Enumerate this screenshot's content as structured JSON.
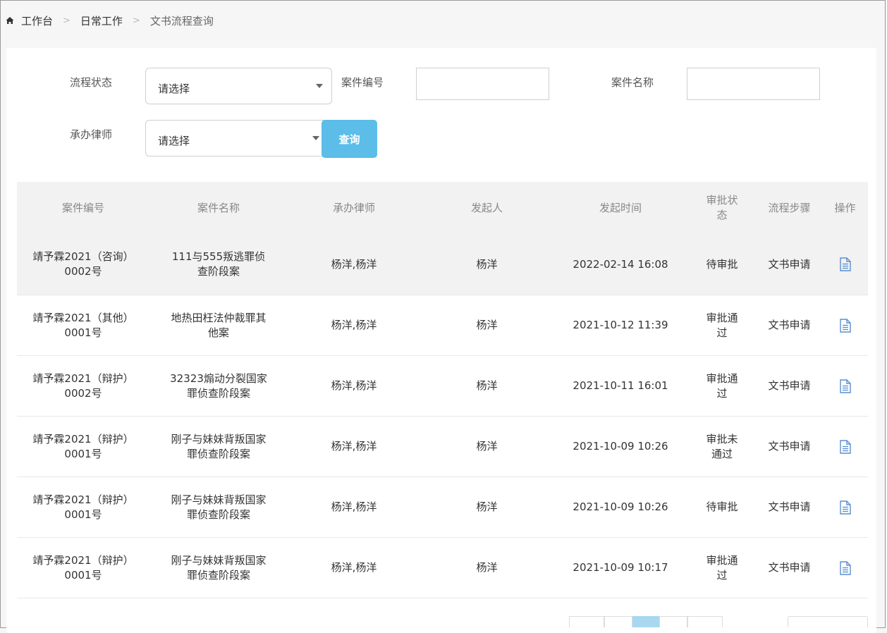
{
  "breadcrumb": {
    "items": [
      "工作台",
      "日常工作",
      "文书流程查询"
    ],
    "separator": ">"
  },
  "filters": {
    "status_label": "流程状态",
    "status_value": "请选择",
    "case_no_label": "案件编号",
    "case_no_value": "",
    "case_name_label": "案件名称",
    "case_name_value": "",
    "lawyer_label": "承办律师",
    "lawyer_value": "请选择",
    "query_button": "查询"
  },
  "table": {
    "headers": [
      "案件编号",
      "案件名称",
      "承办律师",
      "发起人",
      "发起时间",
      "审批状态",
      "流程步骤",
      "操作"
    ],
    "rows": [
      {
        "case_no": "靖予霖2021（咨询）0002号",
        "case_name": "111与555叛逃罪侦查阶段案",
        "lawyer": "杨洋,杨洋",
        "initiator": "杨洋",
        "time": "2022-02-14 16:08",
        "status": "待审批",
        "step": "文书申请"
      },
      {
        "case_no": "靖予霖2021（其他）0001号",
        "case_name": "地热田枉法仲裁罪其他案",
        "lawyer": "杨洋,杨洋",
        "initiator": "杨洋",
        "time": "2021-10-12 11:39",
        "status": "审批通过",
        "step": "文书申请"
      },
      {
        "case_no": "靖予霖2021（辩护）0002号",
        "case_name": "32323煽动分裂国家罪侦查阶段案",
        "lawyer": "杨洋,杨洋",
        "initiator": "杨洋",
        "time": "2021-10-11 16:01",
        "status": "审批通过",
        "step": "文书申请"
      },
      {
        "case_no": "靖予霖2021（辩护）0001号",
        "case_name": "刚子与妹妹背叛国家罪侦查阶段案",
        "lawyer": "杨洋,杨洋",
        "initiator": "杨洋",
        "time": "2021-10-09 10:26",
        "status": "审批未通过",
        "step": "文书申请"
      },
      {
        "case_no": "靖予霖2021（辩护）0001号",
        "case_name": "刚子与妹妹背叛国家罪侦查阶段案",
        "lawyer": "杨洋,杨洋",
        "initiator": "杨洋",
        "time": "2021-10-09 10:26",
        "status": "待审批",
        "step": "文书申请"
      },
      {
        "case_no": "靖予霖2021（辩护）0001号",
        "case_name": "刚子与妹妹背叛国家罪侦查阶段案",
        "lawyer": "杨洋,杨洋",
        "initiator": "杨洋",
        "time": "2021-10-09 10:17",
        "status": "审批通过",
        "step": "文书申请"
      }
    ]
  },
  "icons": {
    "home": "home-icon",
    "action": "document-icon",
    "dropdown": "chevron-down-icon"
  },
  "colors": {
    "accent": "#5bbde8",
    "icon": "#5a8fd0",
    "header_bg": "#f2f2f2",
    "pager_active": "#a7d8f0"
  }
}
